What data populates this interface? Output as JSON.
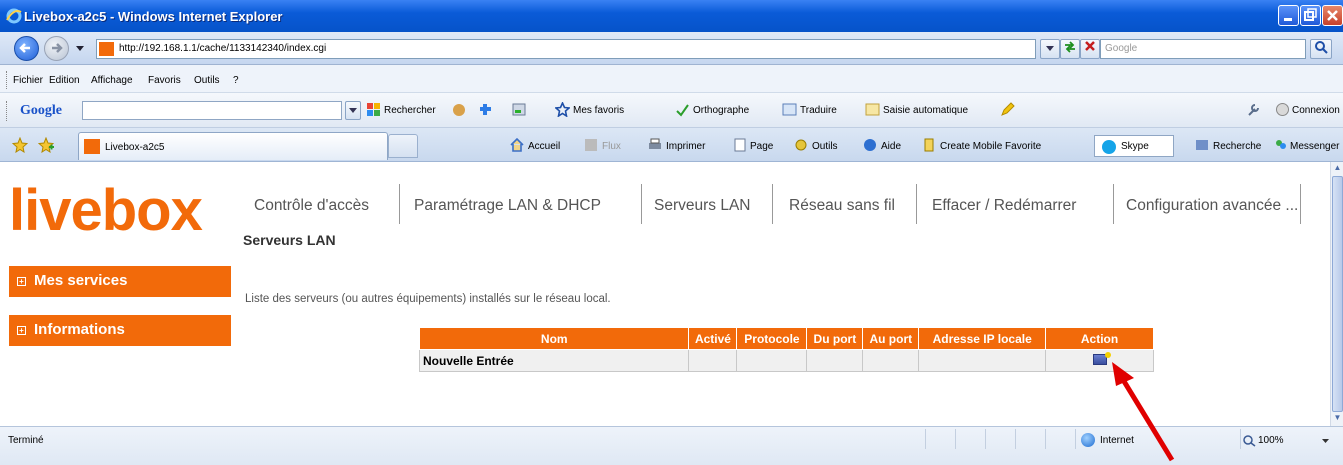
{
  "window": {
    "title": "Livebox-a2c5 - Windows Internet Explorer"
  },
  "address_bar": {
    "url": "http://192.168.1.1/cache/1133142340/index.cgi",
    "search_placeholder": "Google"
  },
  "menu": {
    "items": [
      "Fichier",
      "Edition",
      "Affichage",
      "Favoris",
      "Outils",
      "?"
    ]
  },
  "google_toolbar": {
    "logo": "Google",
    "rechercher": "Rechercher",
    "mes_favoris": "Mes favoris",
    "orthographe": "Orthographe",
    "traduire": "Traduire",
    "saisie": "Saisie automatique",
    "connexion": "Connexion"
  },
  "tabs": {
    "active_label": "Livebox-a2c5"
  },
  "command_bar": {
    "accueil": "Accueil",
    "flux": "Flux",
    "imprimer": "Imprimer",
    "page": "Page",
    "outils": "Outils",
    "aide": "Aide",
    "mobile": "Create Mobile Favorite",
    "skype": "Skype",
    "recherche": "Recherche",
    "messenger": "Messenger"
  },
  "page": {
    "logo": "livebox",
    "nav": [
      "Contrôle d'accès",
      "Paramétrage LAN & DHCP",
      "Serveurs LAN",
      "Réseau sans fil",
      "Effacer / Redémarrer",
      "Configuration avancée ..."
    ],
    "title": "Serveurs LAN",
    "sidebar": {
      "services": "Mes services",
      "informations": "Informations"
    },
    "description": "Liste des serveurs (ou autres équipements) installés sur le réseau local.",
    "table": {
      "headers": [
        "Nom",
        "Activé",
        "Protocole",
        "Du port",
        "Au port",
        "Adresse IP locale",
        "Action"
      ],
      "rows": [
        {
          "nom": "Nouvelle Entrée",
          "active": "",
          "protocole": "",
          "du_port": "",
          "au_port": "",
          "ip": ""
        }
      ]
    }
  },
  "status_bar": {
    "status": "Terminé",
    "zone": "Internet",
    "zoom": "100%"
  },
  "colors": {
    "brand_orange": "#f26a0a",
    "annotation_red": "#e00000"
  }
}
